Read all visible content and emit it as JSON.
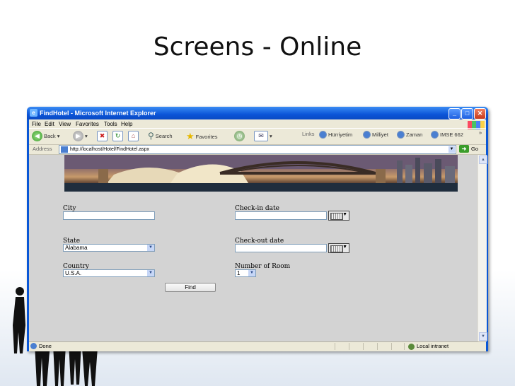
{
  "slide": {
    "title": "Screens - Online"
  },
  "window": {
    "title": "FindHotel - Microsoft Internet Explorer",
    "controls": {
      "minimize": "_",
      "maximize": "□",
      "close": "✕"
    }
  },
  "menu": [
    "File",
    "Edit",
    "View",
    "Favorites",
    "Tools",
    "Help"
  ],
  "toolbar": {
    "back": "Back",
    "search": "Search",
    "favorites": "Favorites",
    "links_label": "Links",
    "links": [
      "Hürriyetim",
      "Milliyet",
      "Zaman",
      "IMSE 662"
    ]
  },
  "address": {
    "label": "Address",
    "url": "http://localhost/Hotel/FindHotel.aspx",
    "go": "Go"
  },
  "form": {
    "city": {
      "label": "City",
      "value": ""
    },
    "state": {
      "label": "State",
      "value": "Alabama"
    },
    "country": {
      "label": "Country",
      "value": "U.S.A."
    },
    "checkin": {
      "label": "Check-in date",
      "value": ""
    },
    "checkout": {
      "label": "Check-out date",
      "value": ""
    },
    "rooms": {
      "label": "Number of Room",
      "value": "1"
    },
    "find_label": "Find"
  },
  "status": {
    "text": "Done",
    "zone": "Local intranet"
  },
  "colors": {
    "titlebar": "#0a57d6",
    "content_bg": "#d3d3d3",
    "chrome": "#ece9d8"
  }
}
